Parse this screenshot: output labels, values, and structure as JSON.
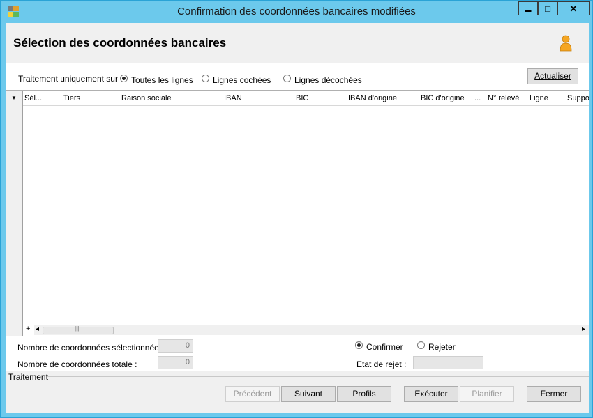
{
  "window": {
    "title": "Confirmation des coordonnées bancaires modifiées",
    "minimize_glyph": "▬",
    "maximize_glyph": "□",
    "close_glyph": "✕"
  },
  "header": {
    "title": "Sélection des coordonnées bancaires",
    "user_icon": "user-icon"
  },
  "filter": {
    "label": "Traitement uniquement sur :",
    "options": [
      {
        "label": "Toutes les lignes",
        "selected": true
      },
      {
        "label": "Lignes cochées",
        "selected": false
      },
      {
        "label": "Lignes décochées",
        "selected": false
      }
    ],
    "refresh_button": "Actualiser"
  },
  "grid": {
    "menu_glyph": "▼",
    "columns": [
      "Sél...",
      "Tiers",
      "Raison sociale",
      "IBAN",
      "BIC",
      "IBAN d'origine",
      "BIC d'origine",
      "...",
      "N° relevé",
      "Ligne",
      "Suppo"
    ],
    "rows": [],
    "add_glyph": "+",
    "scroll_left_glyph": "◂",
    "scroll_right_glyph": "▸",
    "thumb_grip": "|||"
  },
  "summary": {
    "selected_label": "Nombre de coordonnées sélectionnées :",
    "selected_value": "0",
    "total_label": "Nombre de coordonnées totale :",
    "total_value": "0",
    "action_options": [
      {
        "label": "Confirmer",
        "selected": true
      },
      {
        "label": "Rejeter",
        "selected": false
      }
    ],
    "reject_state_label": "Etat de rejet :",
    "reject_state_value": ""
  },
  "footer": {
    "group_label": "Traitement",
    "buttons": {
      "previous": "Précédent",
      "next": "Suivant",
      "profiles": "Profils",
      "execute": "Exécuter",
      "schedule": "Planifier",
      "close": "Fermer"
    }
  },
  "colors": {
    "titlebar": "#6cc9ec",
    "window_border": "#2aa3d6",
    "panel": "#f0f0f0",
    "user_icon": "#f5a623"
  }
}
